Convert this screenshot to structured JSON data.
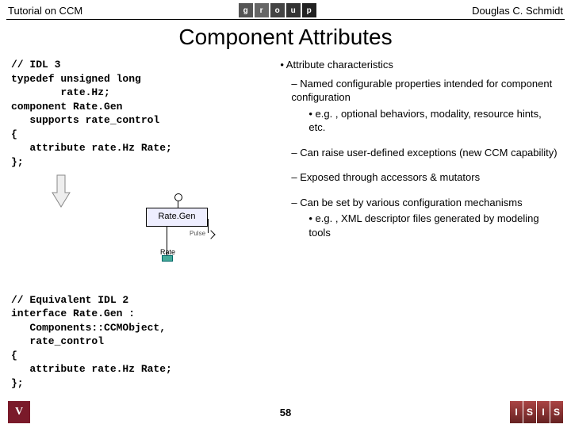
{
  "header": {
    "left": "Tutorial on CCM",
    "right": "Douglas C. Schmidt",
    "logo_text": "group"
  },
  "title": "Component Attributes",
  "code_idl3_comment": "// IDL 3",
  "code_idl3": "typedef unsigned long\n        rate.Hz;\ncomponent Rate.Gen\n   supports rate_control\n{\n   attribute rate.Hz Rate;\n};",
  "code_idl2_comment": "// Equivalent IDL 2",
  "code_idl2": "interface Rate.Gen :\n   Components::CCMObject,\n   rate_control\n{\n   attribute rate.Hz Rate;\n};",
  "diagram": {
    "comp": "Rate.Gen",
    "pulse": "Pulse",
    "rate": "Rate"
  },
  "bullets": {
    "b1": "• Attribute characteristics",
    "b2a": "– Named configurable properties intended for component configuration",
    "b3a": "• e.g. , optional behaviors, modality, resource hints, etc.",
    "b2b": "– Can raise user-defined exceptions (new CCM capability)",
    "b2c": "– Exposed through accessors & mutators",
    "b2d": "– Can be set by various configuration mechanisms",
    "b3b": "• e.g. , XML descriptor files generated by modeling tools"
  },
  "page": "58",
  "footer_v": "V"
}
